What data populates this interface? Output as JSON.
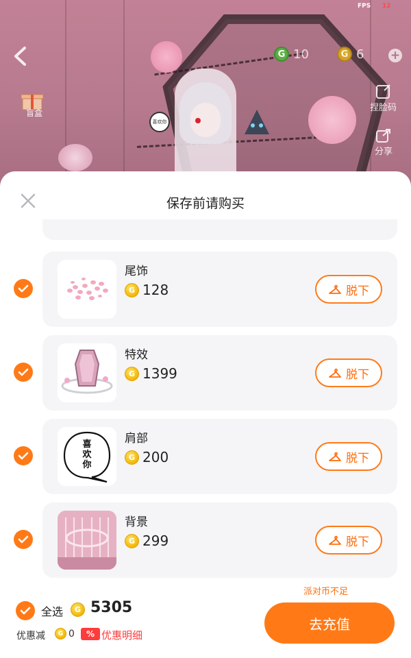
{
  "scene": {
    "fps_label": "FPS",
    "fps_value": "12",
    "green_coin": {
      "symbol": "G",
      "value": "10"
    },
    "gold_coin": {
      "symbol": "G",
      "value": "6"
    },
    "tools": [
      {
        "label": "捏脸码",
        "icon": "face-code-icon"
      },
      {
        "label": "分享",
        "icon": "share-icon"
      }
    ],
    "blind_box_label": "盲盒",
    "speech_bubble": "喜欢你"
  },
  "sheet": {
    "title": "保存前请购买",
    "items": [
      {
        "name": "尾饰",
        "price": "128",
        "action": "脱下",
        "checked": true,
        "thumb": "pink-petals"
      },
      {
        "name": "特效",
        "price": "1399",
        "action": "脱下",
        "checked": true,
        "thumb": "crystal-coffin"
      },
      {
        "name": "肩部",
        "price": "200",
        "action": "脱下",
        "checked": true,
        "thumb": "speech-bubble",
        "thumb_text": "喜欢你"
      },
      {
        "name": "背景",
        "price": "299",
        "action": "脱下",
        "checked": true,
        "thumb": "pink-room"
      }
    ]
  },
  "footer": {
    "insufficient_text": "派对币不足",
    "select_all_label": "全选",
    "total": "5305",
    "discount_label": "优惠减",
    "discount_value": "0",
    "discount_badge": "%",
    "discount_detail": "优惠明细",
    "recharge_label": "去充值"
  },
  "colors": {
    "accent": "#ff7a17",
    "discount_red": "#ff3b3b",
    "card_bg": "#f5f5f7"
  }
}
